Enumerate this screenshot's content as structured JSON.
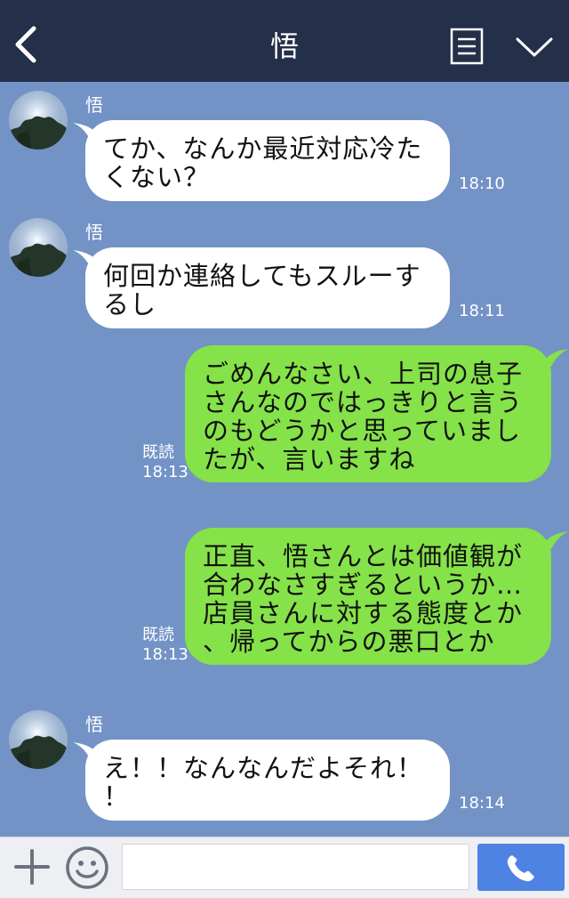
{
  "header": {
    "title": "悟",
    "back_icon": "chevron-left-icon",
    "memo_icon": "note-icon",
    "menu_icon": "chevron-down-icon",
    "background": "#242f49"
  },
  "chat": {
    "background": "#7393c6",
    "messages": [
      {
        "direction": "incoming",
        "sender": "悟",
        "text": "てか、なんか最近対応冷た\nくない？",
        "time": "18:10"
      },
      {
        "direction": "incoming",
        "sender": "悟",
        "text": "何回か連絡してもスルーす\nるし",
        "time": "18:11"
      },
      {
        "direction": "outgoing",
        "read": "既読",
        "text": "ごめんなさい、上司の息子\nさんなのではっきりと言う\nのもどうかと思っていまし\nたが、言いますね",
        "time": "18:13"
      },
      {
        "direction": "outgoing",
        "read": "既読",
        "text": "正直、悟さんとは価値観が\n合わなさすぎるというか…\n店員さんに対する態度とか\n、帰ってからの悪口とか",
        "time": "18:13"
      },
      {
        "direction": "incoming",
        "sender": "悟",
        "text": "え！！なんなんだよそれ！\n！",
        "time": "18:14"
      }
    ],
    "incoming_color": "#ffffff",
    "outgoing_color": "#85e249"
  },
  "footer": {
    "plus_icon": "plus-icon",
    "emoji_icon": "smiley-icon",
    "input_value": "",
    "input_placeholder": "",
    "call_icon": "phone-icon",
    "call_color": "#4f83e3"
  }
}
